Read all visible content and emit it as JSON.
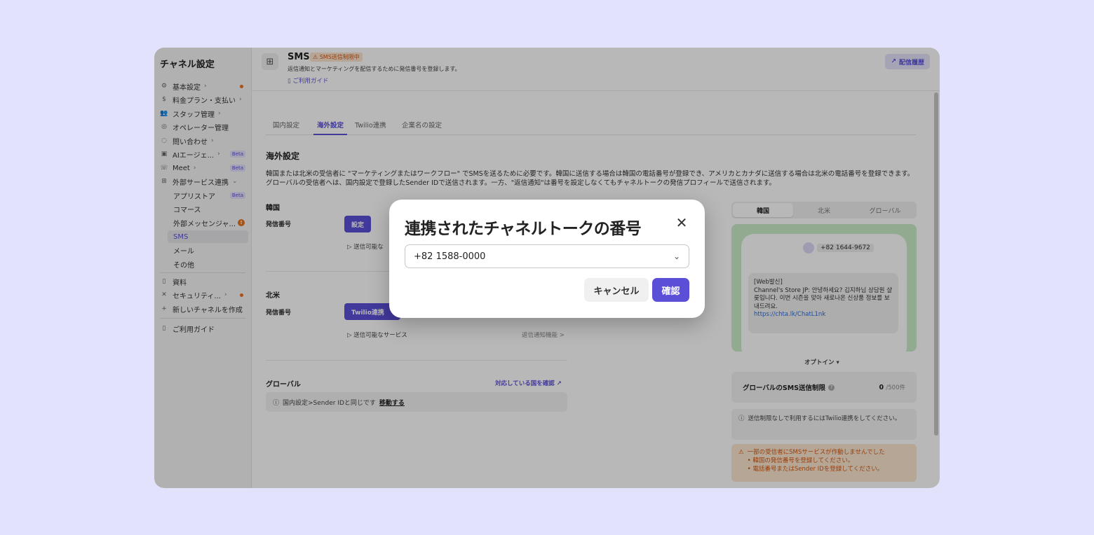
{
  "sidebar": {
    "title": "チャネル設定",
    "items": [
      {
        "label": "基本設定",
        "icon": "gear-icon"
      },
      {
        "label": "料金プラン・支払い",
        "icon": "dollar-icon"
      },
      {
        "label": "スタッフ管理",
        "icon": "people-icon"
      },
      {
        "label": "オペレーター管理",
        "icon": "headset-icon"
      },
      {
        "label": "問い合わせ",
        "icon": "chat-icon"
      },
      {
        "label": "AIエージェ...",
        "icon": "ai-icon",
        "badge": "Beta"
      },
      {
        "label": "Meet",
        "icon": "phone-icon",
        "badge": "Beta"
      },
      {
        "label": "外部サービス連携",
        "icon": "grid-icon"
      }
    ],
    "sub_items": [
      {
        "label": "アプリストア",
        "badge": "Beta"
      },
      {
        "label": "コマース"
      },
      {
        "label": "外部メッセンジャ..."
      },
      {
        "label": "SMS"
      },
      {
        "label": "メール"
      },
      {
        "label": "その他"
      }
    ],
    "bottom_items": [
      {
        "label": "資料",
        "icon": "book-icon"
      },
      {
        "label": "セキュリティ...",
        "icon": "tools-icon"
      },
      {
        "label": "新しいチャネルを作成",
        "icon": "plus-icon"
      },
      {
        "label": "ご利用ガイド",
        "icon": "book-icon"
      }
    ]
  },
  "header": {
    "title": "SMS",
    "badge": "SMS送信制限中",
    "description": "返信通知とマーケティングを配信するために発信番号を登録します。",
    "guide_link": "ご利用ガイド",
    "history_button": "配信履歴"
  },
  "tabs": [
    "国内設定",
    "海外設定",
    "Twilio連携",
    "企業名の設定"
  ],
  "active_tab": "海外設定",
  "section": {
    "title": "海外設定",
    "description": "韓国または北米の受信者に \"マーケティングまたはワークフロー\" でSMSを送るために必要です。韓国に送信する場合は韓国の電話番号が登録でき、アメリカとカナダに送信する場合は北米の電話番号を登録できます。グローバルの受信者へは、国内設定で登録したSender IDで送信されます。一方、\"返信通知\"は番号を設定しなくてもチャネルトークの発信プロフィールで送信されます。"
  },
  "korea": {
    "label": "韓国",
    "sender_label": "発信番号",
    "button": "設定",
    "services": "送信可能な"
  },
  "north_america": {
    "label": "北米",
    "sender_label": "発信番号",
    "button": "Twilio連携",
    "services": "送信可能なサービス",
    "services_link": "返信通知機能 >"
  },
  "global": {
    "label": "グローバル",
    "link": "対応している国を確認",
    "info": "国内設定>Sender IDと同じです",
    "info_link": "移動する"
  },
  "preview": {
    "region_tabs": [
      "韓国",
      "北米",
      "グローバル"
    ],
    "active_region": "韓国",
    "phone_number": "+82 1644-9672",
    "message_lines": [
      "[Web발신]",
      "Channel's Store JP: 안녕하세요? 김지하님 상담원 샬롯입니다. 이번 시즌을 맞아 새로나온 신상품 정보를 보내드려요."
    ],
    "message_url": "https://chta.lk/ChatL1nk",
    "optin": "オプトイン"
  },
  "limit": {
    "title": "グローバルのSMS送信制限",
    "value": "0",
    "max": "/500件"
  },
  "note": "送信制限なしで利用するにはTwilio連携をしてください。",
  "warning": {
    "title": "一部の受信者にSMSサービスが作動しませんでした",
    "items": [
      "• 韓国の発信番号を登録してください。",
      "• 電話番号またはSender IDを登録してください。"
    ]
  },
  "modal": {
    "title": "連携されたチャネルトークの番号",
    "selected_number": "+82 1588-0000",
    "cancel": "キャンセル",
    "confirm": "確認"
  },
  "colors": {
    "accent": "#5b4fd8",
    "background": "#e3e2fc",
    "warning": "#d4570f"
  }
}
